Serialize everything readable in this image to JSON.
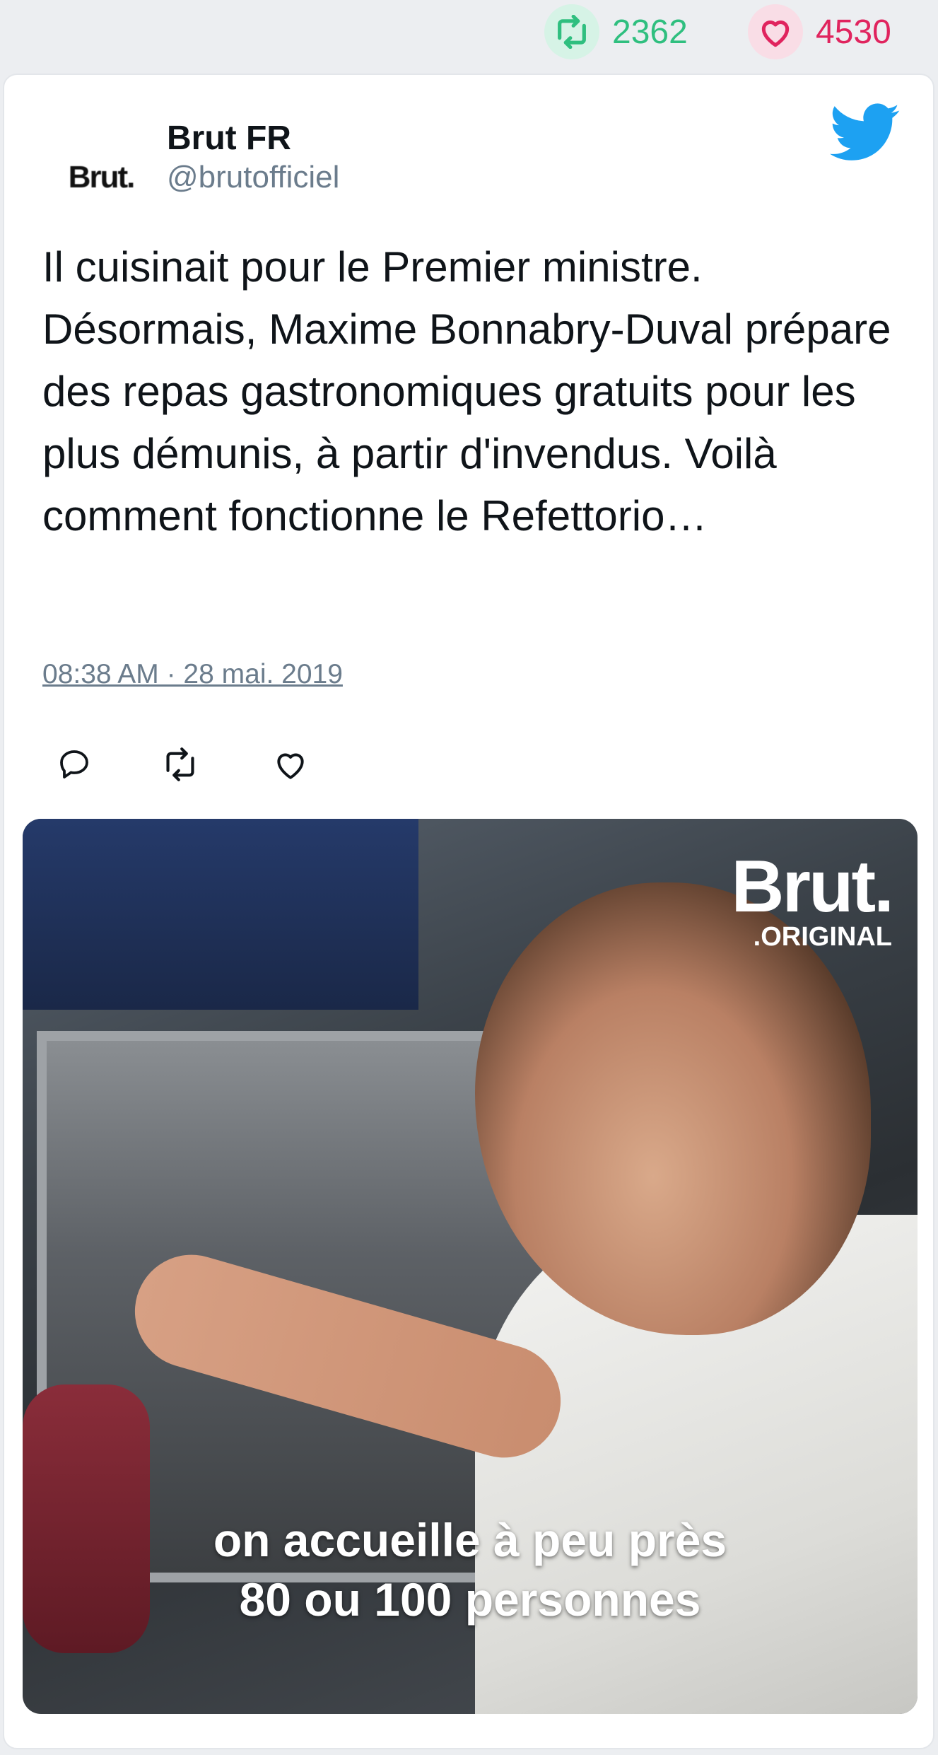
{
  "stats": {
    "retweet_icon": "retweet-icon",
    "retweet_count": "2362",
    "like_icon": "heart-icon",
    "like_count": "4530"
  },
  "tweet": {
    "author": {
      "avatar_text": "Brut.",
      "name": "Brut FR",
      "handle": "@brutofficiel"
    },
    "platform_icon": "twitter-bird-icon",
    "text": "Il cuisinait pour le Premier ministre. Désormais, Maxime Bonnabry-Duval prépare des repas gastronomiques gratuits pour les plus démunis, à partir d'invendus. Voilà comment fonctionne le Refettorio…",
    "timestamp": "08:38 AM · 28 mai. 2019",
    "actions": [
      "reply-icon",
      "retweet-icon",
      "heart-icon"
    ],
    "media": {
      "logo_main": "Brut.",
      "logo_sub": ".ORIGINAL",
      "caption_line1": "on accueille à peu près",
      "caption_line2": "80 ou 100 personnes"
    }
  },
  "colors": {
    "retweet": "#2fbf7f",
    "like": "#e0245e",
    "twitter_blue": "#1da1f2",
    "secondary_text": "#6b7c8c"
  }
}
